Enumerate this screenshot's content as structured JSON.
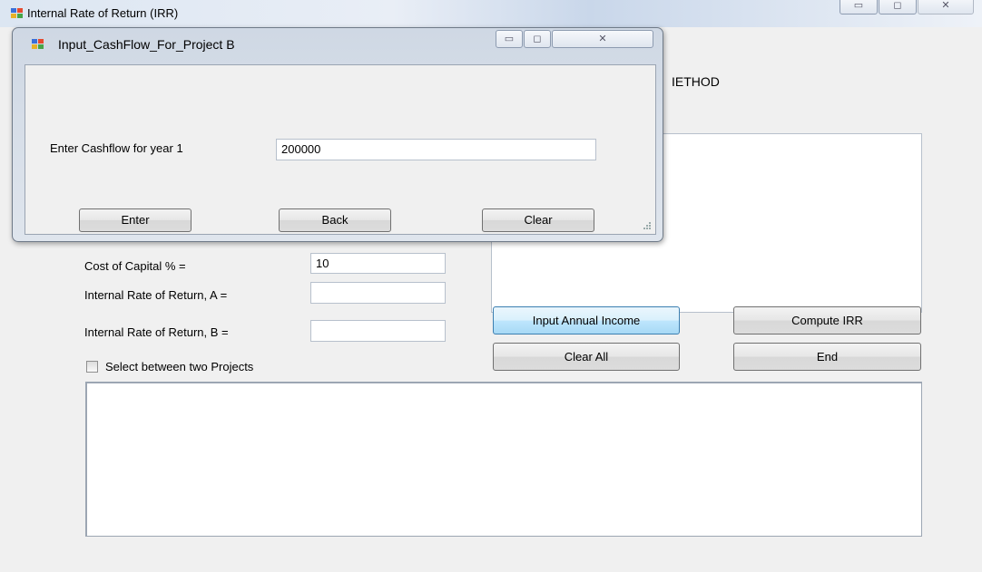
{
  "main_window": {
    "title": "Internal Rate of Return (IRR)",
    "caption_buttons": [
      "▭",
      "◻",
      "✕"
    ]
  },
  "method_label": "IETHOD",
  "form": {
    "cost_of_capital_label": "Cost of Capital % =",
    "cost_of_capital_value": "10",
    "irr_a_label": "Internal Rate of Return, A =",
    "irr_a_value": "",
    "irr_b_label": "Internal Rate of Return, B =",
    "irr_b_value": "",
    "select_projects_label": "Select between two Projects",
    "select_projects_checked": false
  },
  "buttons": {
    "input_annual_income": "Input Annual Income",
    "compute_irr": "Compute IRR",
    "clear_all": "Clear All",
    "end": "End"
  },
  "dialog": {
    "title": "Input_CashFlow_For_Project B",
    "caption_buttons": [
      "▭",
      "◻",
      "✕"
    ],
    "prompt_label": "Enter Cashflow for year 1",
    "cashflow_value": "200000",
    "buttons": {
      "enter": "Enter",
      "back": "Back",
      "clear": "Clear"
    }
  },
  "colors": {
    "window_bg": "#f0f0f0",
    "focus_blue": "#3c7fb1",
    "title_gradient": "#dce6f2"
  },
  "icons": [
    "app-icon",
    "minimize-icon",
    "maximize-icon",
    "close-icon",
    "checkbox-icon",
    "resize-grip-icon"
  ]
}
